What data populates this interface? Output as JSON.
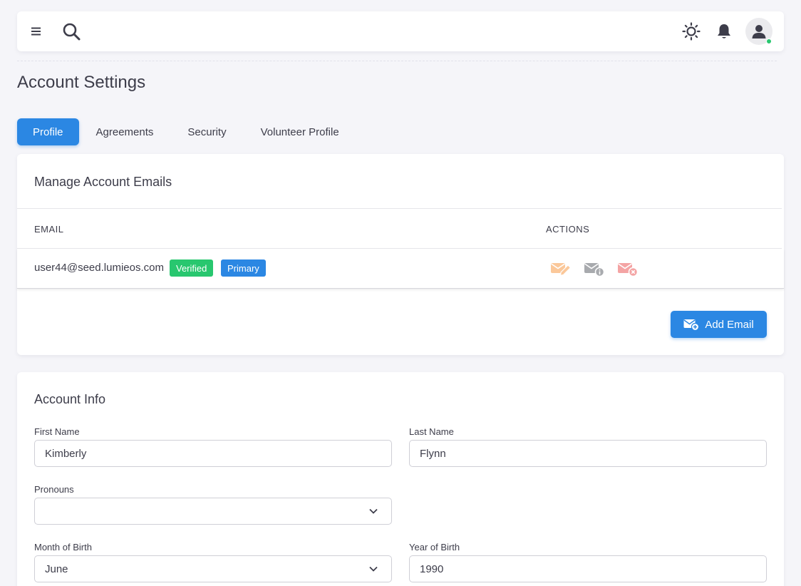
{
  "header": {
    "menu_icon": "hamburger-icon",
    "search_icon": "search-icon",
    "theme_icon": "sun-icon",
    "notifications_icon": "bell-icon",
    "avatar_icon": "user-icon",
    "online_status_color": "#28c76f"
  },
  "page": {
    "title": "Account Settings"
  },
  "tabs": [
    {
      "label": "Profile",
      "active": true
    },
    {
      "label": "Agreements",
      "active": false
    },
    {
      "label": "Security",
      "active": false
    },
    {
      "label": "Volunteer Profile",
      "active": false
    }
  ],
  "emails_card": {
    "title": "Manage Account Emails",
    "columns": {
      "email": "EMAIL",
      "actions": "ACTIONS"
    },
    "rows": [
      {
        "email": "user44@seed.lumieos.com",
        "badges": {
          "verified": "Verified",
          "primary": "Primary"
        },
        "actions": [
          "email-edit-icon",
          "email-info-icon",
          "email-delete-icon"
        ]
      }
    ],
    "add_button": "Add Email"
  },
  "account_info": {
    "title": "Account Info",
    "first_name": {
      "label": "First Name",
      "value": "Kimberly"
    },
    "last_name": {
      "label": "Last Name",
      "value": "Flynn"
    },
    "pronouns": {
      "label": "Pronouns",
      "value": ""
    },
    "month_of_birth": {
      "label": "Month of Birth",
      "value": "June"
    },
    "year_of_birth": {
      "label": "Year of Birth",
      "value": "1990"
    }
  },
  "colors": {
    "primary": "#2b87e3",
    "success": "#28c76f",
    "warning": "#ff9f43",
    "danger": "#ea5455",
    "secondary": "#a8aaae"
  }
}
